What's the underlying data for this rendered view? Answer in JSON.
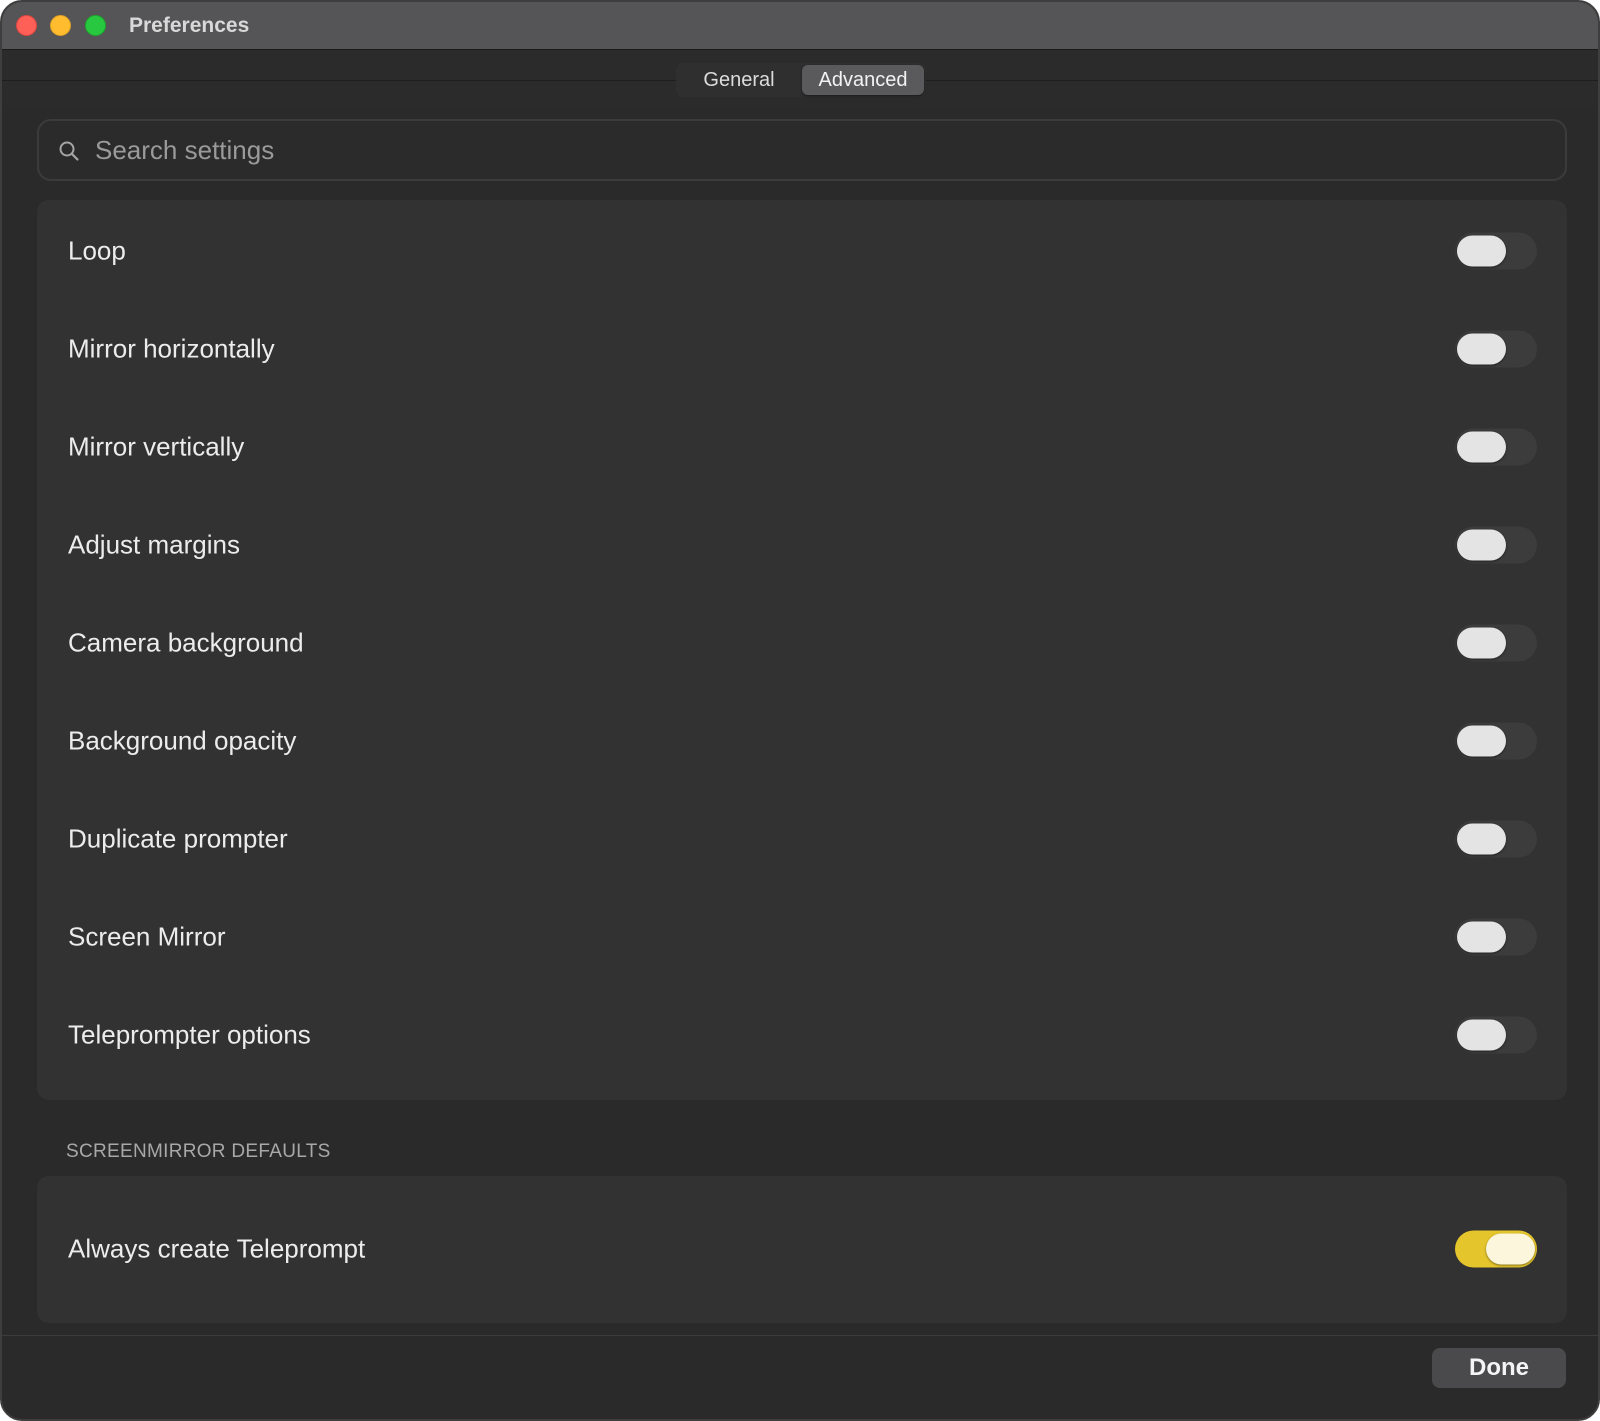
{
  "window": {
    "title": "Preferences"
  },
  "tabs": [
    {
      "label": "General",
      "active": false
    },
    {
      "label": "Advanced",
      "active": true
    }
  ],
  "search": {
    "placeholder": "Search settings",
    "value": "",
    "icon": "search-icon"
  },
  "settings": {
    "items": [
      {
        "label": "Loop",
        "enabled": false
      },
      {
        "label": "Mirror horizontally",
        "enabled": false
      },
      {
        "label": "Mirror vertically",
        "enabled": false
      },
      {
        "label": "Adjust margins",
        "enabled": false
      },
      {
        "label": "Camera background",
        "enabled": false
      },
      {
        "label": "Background opacity",
        "enabled": false
      },
      {
        "label": "Duplicate prompter",
        "enabled": false
      },
      {
        "label": "Screen Mirror",
        "enabled": false
      },
      {
        "label": "Teleprompter options",
        "enabled": false
      }
    ]
  },
  "screenmirror_defaults": {
    "header": "SCREENMIRROR DEFAULTS",
    "items": [
      {
        "label": "Always create Teleprompt",
        "enabled": true
      }
    ]
  },
  "footer": {
    "done_label": "Done"
  },
  "colors": {
    "accent_toggle_on": "#e4c52c",
    "close": "#fe5f57",
    "minimize": "#febc2e",
    "maximize": "#28c840"
  }
}
